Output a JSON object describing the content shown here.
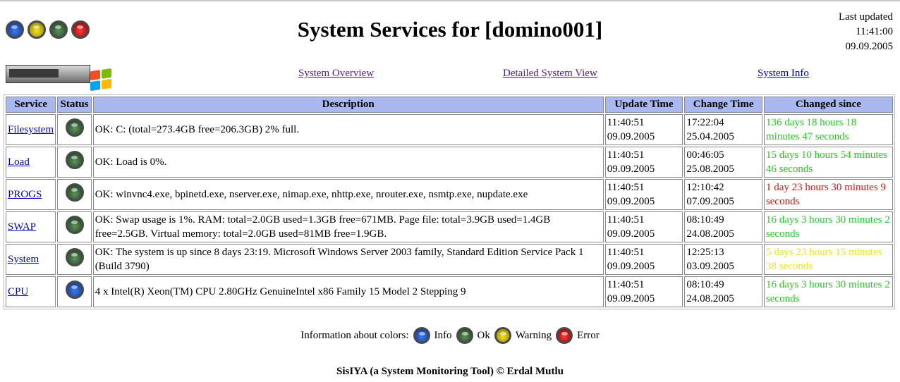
{
  "header": {
    "title": "System Services for [domino001]",
    "last_updated_label": "Last updated",
    "last_updated_time": "11:41:00",
    "last_updated_date": "09.09.2005",
    "status_lights": [
      "info",
      "warning",
      "ok",
      "error"
    ]
  },
  "nav": {
    "overview": "System Overview",
    "detailed": "Detailed System View",
    "info": "System Info"
  },
  "table": {
    "headers": [
      "Service",
      "Status",
      "Description",
      "Update Time",
      "Change Time",
      "Changed since"
    ],
    "rows": [
      {
        "service": "Filesystem",
        "status": "ok",
        "description": "OK: C: (total=273.4GB free=206.3GB) 2% full.",
        "update_time": "11:40:51",
        "update_date": "09.09.2005",
        "change_time": "17:22:04",
        "change_date": "25.04.2005",
        "changed_since": "136 days 18 hours 18 minutes 47 seconds",
        "since_color": "#1fcf1f"
      },
      {
        "service": "Load",
        "status": "ok",
        "description": "OK: Load is 0%.",
        "update_time": "11:40:51",
        "update_date": "09.09.2005",
        "change_time": "00:46:05",
        "change_date": "25.08.2005",
        "changed_since": "15 days 10 hours 54 minutes 46 seconds",
        "since_color": "#1fcf1f"
      },
      {
        "service": "PROGS",
        "status": "ok",
        "description": "OK: winvnc4.exe, bpinetd.exe, nserver.exe, nimap.exe, nhttp.exe, nrouter.exe, nsmtp.exe, nupdate.exe",
        "update_time": "11:40:51",
        "update_date": "09.09.2005",
        "change_time": "12:10:42",
        "change_date": "07.09.2005",
        "changed_since": "1 day 23 hours 30 minutes 9 seconds",
        "since_color": "#e01010"
      },
      {
        "service": "SWAP",
        "status": "ok",
        "description": "OK: Swap usage is 1%. RAM: total=2.0GB used=1.3GB free=671MB. Page file: total=3.9GB used=1.4GB free=2.5GB. Virtual memory: total=2.0GB used=81MB free=1.9GB.",
        "update_time": "11:40:51",
        "update_date": "09.09.2005",
        "change_time": "08:10:49",
        "change_date": "24.08.2005",
        "changed_since": "16 days 3 hours 30 minutes 2 seconds",
        "since_color": "#1fcf1f"
      },
      {
        "service": "System",
        "status": "ok",
        "description": "OK: The system is up since 8 days 23:19. Microsoft Windows Server 2003 family, Standard Edition Service Pack 1 (Build 3790)",
        "update_time": "11:40:51",
        "update_date": "09.09.2005",
        "change_time": "12:25:13",
        "change_date": "03.09.2005",
        "changed_since": "5 days 23 hours 15 minutes 38 seconds",
        "since_color": "#f0e020"
      },
      {
        "service": "CPU",
        "status": "info",
        "description": "4 x Intel(R) Xeon(TM) CPU 2.80GHz GenuineIntel x86 Family 15 Model 2 Stepping 9",
        "update_time": "11:40:51",
        "update_date": "09.09.2005",
        "change_time": "08:10:49",
        "change_date": "24.08.2005",
        "changed_since": "16 days 3 hours 30 minutes 2 seconds",
        "since_color": "#1fcf1f"
      }
    ]
  },
  "legend": {
    "label": "Information about colors:",
    "info": "Info",
    "ok": "Ok",
    "warning": "Warning",
    "error": "Error"
  },
  "footer": {
    "text": "SisIYA (a System Monitoring Tool) © Erdal Mutlu"
  },
  "colors": {
    "header_bg": "#a9b9ef",
    "ok_text": "#1fcf1f",
    "warning_text": "#f0e020",
    "error_text": "#e01010"
  }
}
